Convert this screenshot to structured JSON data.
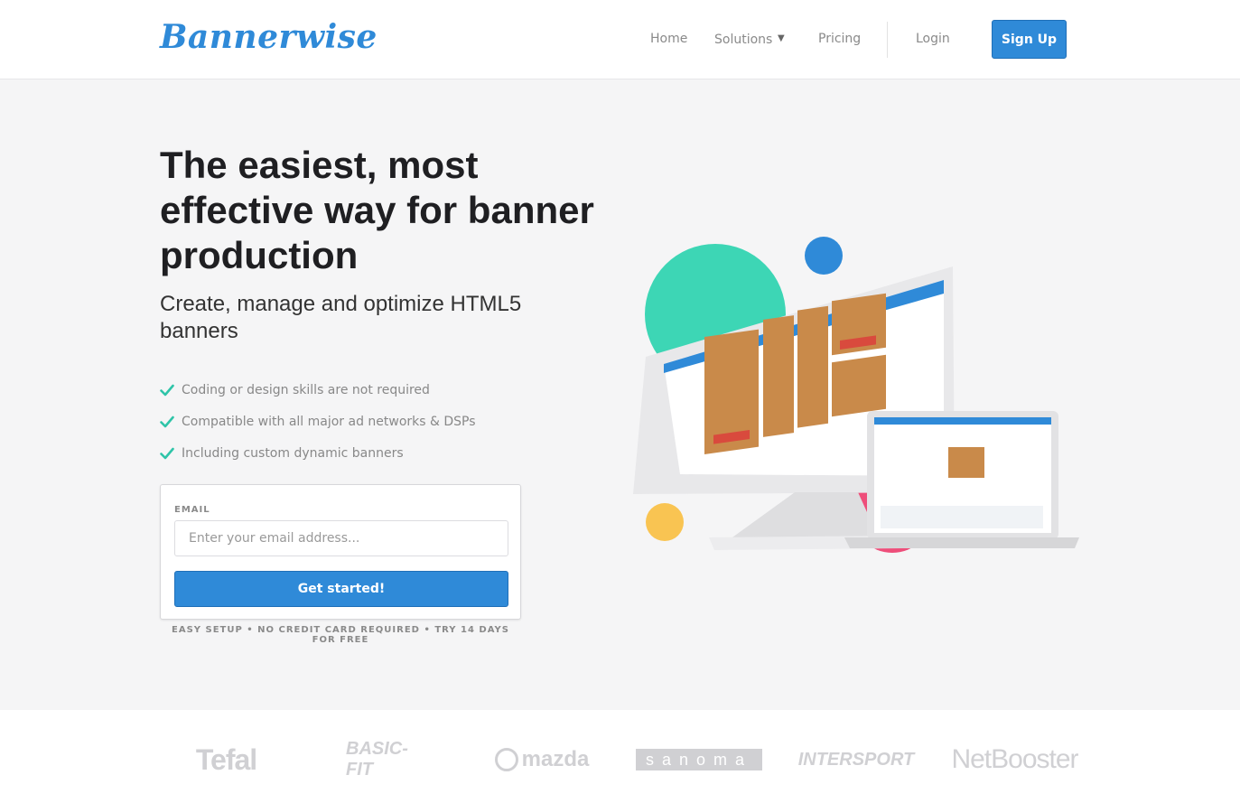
{
  "nav": {
    "logo_text": "Bannerwise",
    "links": {
      "home": "Home",
      "solutions": "Solutions",
      "pricing": "Pricing",
      "login": "Login"
    },
    "signup_label": "Sign Up"
  },
  "hero": {
    "headline": "The easiest, most effective way for banner production",
    "subheadline": "Create, manage and optimize HTML5 banners",
    "features": [
      "Coding or design skills are not required",
      "Compatible with all major ad networks & DSPs",
      "Including custom dynamic banners"
    ],
    "form": {
      "email_label": "EMAIL",
      "email_placeholder": "Enter your email address...",
      "email_value": "",
      "submit_label": "Get started!"
    },
    "fineprint": "EASY SETUP • NO CREDIT CARD REQUIRED • TRY 14 DAYS FOR FREE"
  },
  "clients": {
    "tefal": "Tefal",
    "basicfit": "BASIC-FIT",
    "mazda": "mazda",
    "sanoma": "sanoma",
    "intersport": "INTERSPORT",
    "netbooster": "NetBooster"
  },
  "colors": {
    "accent": "#2f8ad8",
    "check": "#2ec4a8",
    "circle_teal": "#3dd6b5",
    "circle_blue": "#2f8ad8",
    "circle_yellow": "#f9c452",
    "circle_pink": "#ee4e7a"
  },
  "icons": {
    "feature_bullet": "check-icon",
    "solutions_caret": "caret-down-icon"
  }
}
